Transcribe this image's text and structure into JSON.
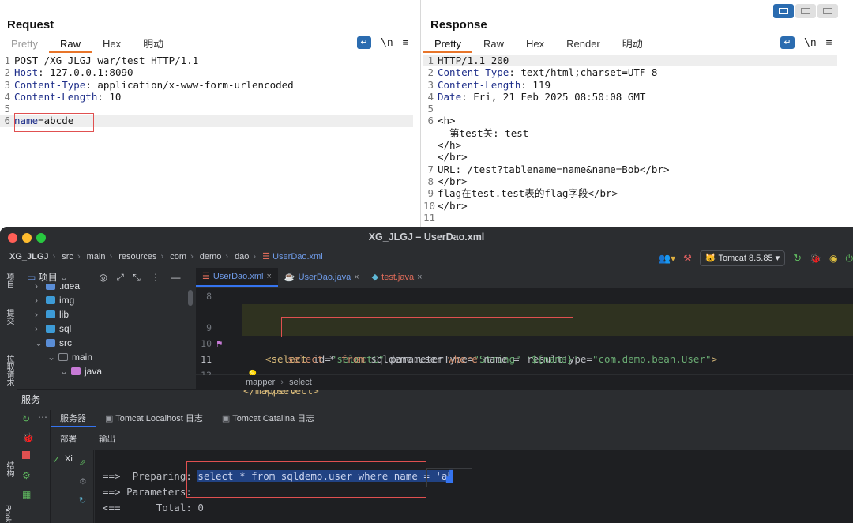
{
  "request": {
    "title": "Request",
    "tabs": [
      "Pretty",
      "Raw",
      "Hex",
      "明动"
    ],
    "active_tab": "Raw",
    "newline_label": "\\n",
    "lines": [
      {
        "n": "1",
        "k": "",
        "v": "POST /XG_JLGJ_war/test HTTP/1.1"
      },
      {
        "n": "2",
        "k": "Host",
        "v": ": 127.0.0.1:8090"
      },
      {
        "n": "3",
        "k": "Content-Type",
        "v": ": application/x-www-form-urlencoded"
      },
      {
        "n": "4",
        "k": "Content-Length",
        "v": ": 10"
      },
      {
        "n": "5",
        "k": "",
        "v": ""
      },
      {
        "n": "6",
        "k": "name",
        "v": "=abcde"
      }
    ]
  },
  "response": {
    "title": "Response",
    "tabs": [
      "Pretty",
      "Raw",
      "Hex",
      "Render",
      "明动"
    ],
    "active_tab": "Pretty",
    "newline_label": "\\n",
    "lines": [
      {
        "n": "1",
        "text": "HTTP/1.1 200"
      },
      {
        "n": "2",
        "k": "Content-Type",
        "v": ": text/html;charset=UTF-8"
      },
      {
        "n": "3",
        "k": "Content-Length",
        "v": ": 119"
      },
      {
        "n": "4",
        "k": "Date",
        "v": ": Fri, 21 Feb 2025 08:50:08 GMT"
      },
      {
        "n": "5",
        "text": ""
      },
      {
        "n": "6",
        "text": "<h>"
      },
      {
        "n": "",
        "text": "  第test关: test"
      },
      {
        "n": "",
        "text": "</h>"
      },
      {
        "n": "",
        "text": "</br>"
      },
      {
        "n": "7",
        "text": "URL: /test?tablename=name&name=Bob</br>"
      },
      {
        "n": "8",
        "text": "</br>"
      },
      {
        "n": "9",
        "text": "flag在test.test表的flag字段</br>"
      },
      {
        "n": "10",
        "text": "</br>"
      },
      {
        "n": "11",
        "text": ""
      }
    ]
  },
  "ide": {
    "window_title": "XG_JLGJ – UserDao.xml",
    "breadcrumb": [
      "XG_JLGJ",
      "src",
      "main",
      "resources",
      "com",
      "demo",
      "dao",
      "UserDao.xml"
    ],
    "run_config": "Tomcat 8.5.85",
    "left_labels": [
      "项目",
      "提交",
      "拉取请求",
      "结构",
      "Bookmarks"
    ],
    "project_header": "项目",
    "tree": [
      {
        "label": ".idea",
        "indent": 1,
        "color": "#5a8dd6"
      },
      {
        "label": "img",
        "indent": 1,
        "color": "#3d9bd6"
      },
      {
        "label": "lib",
        "indent": 1,
        "color": "#3d9bd6"
      },
      {
        "label": "sql",
        "indent": 1,
        "color": "#3d9bd6"
      },
      {
        "label": "src",
        "indent": 1,
        "color": "#5a8dd6"
      },
      {
        "label": "main",
        "indent": 2,
        "color": "#8a8d93"
      },
      {
        "label": "java",
        "indent": 3,
        "color": "#c77ad6"
      }
    ],
    "tabs": [
      "UserDao.xml",
      "UserDao.java",
      "test.java"
    ],
    "active_tab": "UserDao.xml",
    "code_lines": [
      {
        "n": "8",
        "text": ""
      },
      {
        "n": "9",
        "text": "<select id=\"selectC\" parameterType=\"String\" resultType=\"com.demo.bean.User\">"
      },
      {
        "n": "10",
        "text": "select * from sqldemo.user where name = '${name}'"
      },
      {
        "n": "11",
        "text": "</select>"
      },
      {
        "n": "12",
        "text": "</mapper>"
      }
    ],
    "editor_crumbs": [
      "mapper",
      "select"
    ],
    "services_title": "服务",
    "service_tabs": [
      "服务器",
      "Tomcat Localhost 日志",
      "Tomcat Catalina 日志"
    ],
    "sub_tabs": [
      "部署",
      "输出"
    ],
    "service_item": "Xi",
    "console": {
      "line1_prefix": "==>  Preparing: ",
      "line1_sql": "select * from sqldemo.user where name = 'ab",
      "line2": "==> Parameters: ",
      "line3": "<==      Total: 0"
    }
  },
  "colors": {
    "accent": "#e8752a",
    "ide_blue": "#3574f0",
    "highlight_red": "#e05050"
  }
}
